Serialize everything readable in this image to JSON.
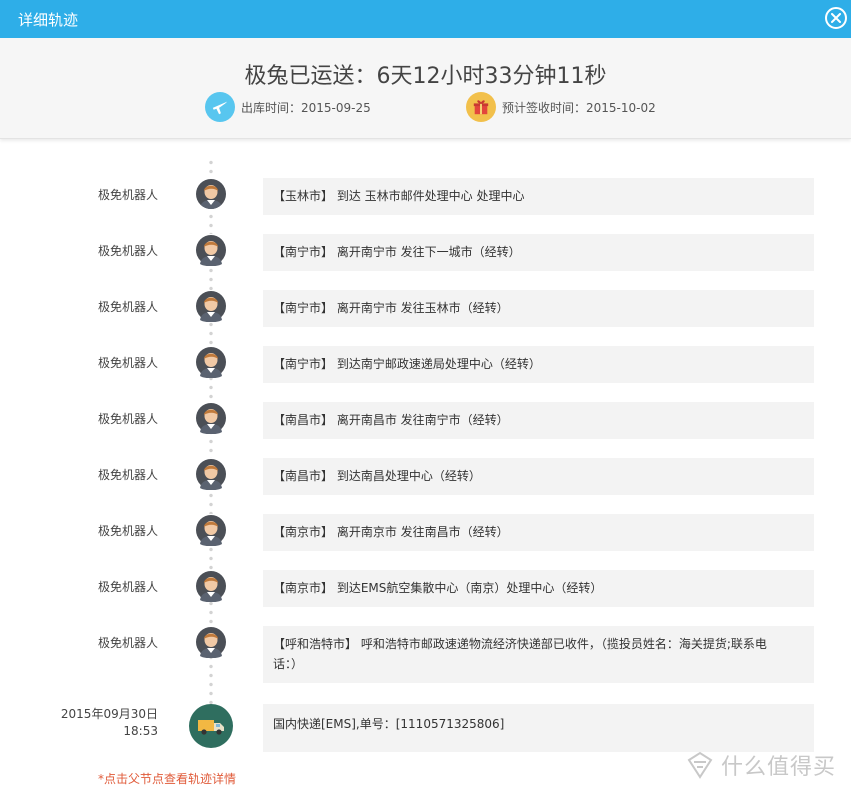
{
  "window": {
    "title": "详细轨迹",
    "close_icon": "close-icon"
  },
  "summary": {
    "headline": "极兔已运送：6天12小时33分钟11秒",
    "ship_label": "出库时间：2015-09-25",
    "ship_icon": "airplane-icon",
    "eta_label": "预计签收时间：2015-10-02",
    "eta_icon": "gift-icon",
    "colors": {
      "ship_icon_bg": "#58c6ef",
      "eta_icon_bg": "#f2c04b"
    }
  },
  "events": [
    {
      "who": "极免机器人",
      "text": "【玉林市】 到达 玉林市邮件处理中心 处理中心"
    },
    {
      "who": "极免机器人",
      "text": "【南宁市】 离开南宁市 发往下一城市（经转）"
    },
    {
      "who": "极免机器人",
      "text": "【南宁市】 离开南宁市 发往玉林市（经转）"
    },
    {
      "who": "极免机器人",
      "text": "【南宁市】 到达南宁邮政速递局处理中心（经转）"
    },
    {
      "who": "极免机器人",
      "text": "【南昌市】 离开南昌市 发往南宁市（经转）"
    },
    {
      "who": "极免机器人",
      "text": "【南昌市】 到达南昌处理中心（经转）"
    },
    {
      "who": "极免机器人",
      "text": "【南京市】 离开南京市 发往南昌市（经转）"
    },
    {
      "who": "极免机器人",
      "text": "【南京市】 到达EMS航空集散中心（南京）处理中心（经转）"
    },
    {
      "who": "极免机器人",
      "text": "【呼和浩特市】 呼和浩特市邮政速递物流经济快递部已收件，（揽投员姓名：海关提货;联系电话：）"
    }
  ],
  "origin": {
    "date": "2015年09月30日",
    "time": "18:53",
    "text": "国内快递[EMS],单号：[1110571325806]",
    "icon": "truck-icon"
  },
  "hint": "*点击父节点查看轨迹详情",
  "watermark": {
    "text": "什么值得买",
    "icon": "smzdm-logo-icon"
  }
}
